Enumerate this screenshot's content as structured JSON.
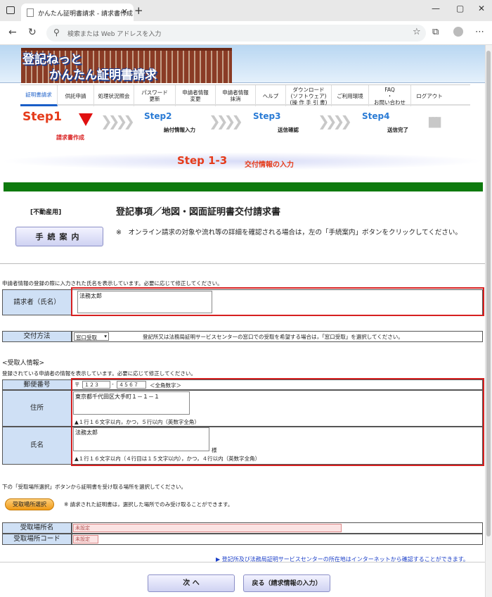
{
  "browser": {
    "tab_title": "かんたん証明書請求 - 請求書作成",
    "tab_close": "✕",
    "new_tab": "+",
    "win_min": "—",
    "win_max": "▢",
    "win_close": "✕",
    "back": "←",
    "reload": "↻",
    "address_placeholder": "検索または Web アドレスを入力"
  },
  "banner": {
    "logo_line1": "登記ねっと",
    "logo_line2": "かんたん証明書請求"
  },
  "menu": [
    {
      "label": "証明書請求",
      "active": true
    },
    {
      "label": "供託申請"
    },
    {
      "label": "処理状況照会"
    },
    {
      "label": "パスワード\n更新"
    },
    {
      "label": "申請者情報\n変更"
    },
    {
      "label": "申請者情報\n抹消"
    },
    {
      "label": "ヘルプ"
    },
    {
      "label": "ダウンロード\n(ソフトウェア)\n(操 作 手 引 書)"
    },
    {
      "label": "ご利用環境"
    },
    {
      "label": "FAQ\n・\nお問い合わせ"
    },
    {
      "label": "ログアウト"
    }
  ],
  "steps": {
    "step1": "Step1",
    "step1_sub": "請求書作成",
    "step2": "Step2",
    "step2_sub": "納付情報入力",
    "step3": "Step3",
    "step3_sub": "送信確認",
    "step4": "Step4",
    "step4_sub": "送信完了",
    "chevrons": "❯❯❯❯"
  },
  "step_header": {
    "title": "Step 1-3",
    "subtitle": "交付情報の入力"
  },
  "form": {
    "category": "[不動産用]",
    "title": "登記事項／地図・図面証明書交付請求書",
    "guide_button": "手続案内",
    "guide_note": "※　オンライン請求の対象や流れ等の詳細を確認される場合は，左の「手続案内」ボタンをクリックしてください。"
  },
  "applicant": {
    "info": "申請者情報の登録の際に入力された氏名を表示しています。必要に応じて修正してください。",
    "label": "請求者（氏名）",
    "value": "法務太郎"
  },
  "delivery": {
    "label": "交付方法",
    "selected": "窓口受取",
    "note": "登記所又は法務局証明サービスセンターの窓口での受取を希望する場合は，「窓口受取」を選択してください。"
  },
  "recipient": {
    "section": "<受取人情報>",
    "info": "登録されている申請者の情報を表示しています。必要に応じて修正してください。",
    "postal_label": "郵便番号",
    "postal_mark": "〒",
    "postal1": "１２３",
    "postal_sep": "-",
    "postal2": "４５６７",
    "postal_note": "＜全角数字＞",
    "address_label": "住所",
    "address_value": "東京都千代田区大手町１－１－１",
    "address_note": "▲１行１６文字以内，かつ，５行以内（英数字全角）",
    "name_label": "氏名",
    "name_value": "法務太郎",
    "name_suffix": "様",
    "name_note": "▲１行１６文字以内（４行目は１５文字以内），かつ，４行以内（英数字全角）"
  },
  "pickup": {
    "instruction": "下の「受取場所選択」ボタンから証明書を受け取る場所を選択してください。",
    "button": "受取場所選択",
    "note": "※ 請求された証明書は，選択した場所でのみ受け取ることができます。",
    "place_label": "受取場所名",
    "place_value": "未設定",
    "code_label": "受取場所コード",
    "code_value": "未設定",
    "link": "▶ 登記所及び法務局証明サービスセンターの所在地はインターネットから確認することができます。"
  },
  "actions": {
    "next": "次 へ",
    "back": "戻る（請求情報の入力）"
  }
}
